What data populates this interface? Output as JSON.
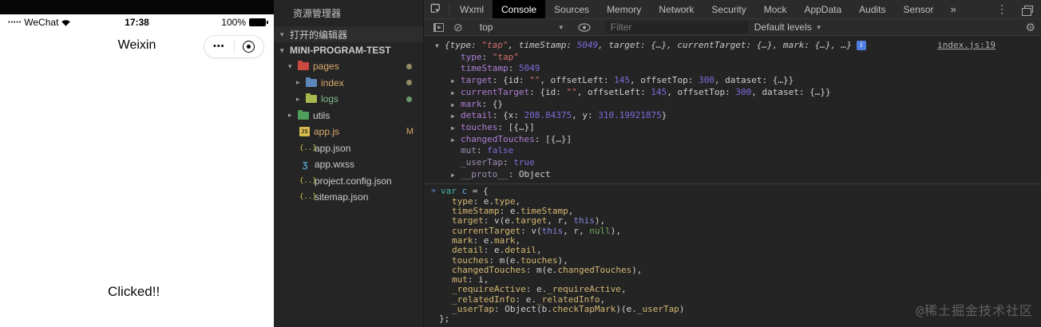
{
  "simulator": {
    "status": {
      "carrier_dots": "•••••",
      "carrier": "WeChat",
      "time": "17:38",
      "battery_pct": "100%"
    },
    "nav": {
      "title": "Weixin",
      "menu_dots": "•••"
    },
    "content": {
      "clicked_text": "Clicked!!"
    }
  },
  "explorer": {
    "title": "资源管理器",
    "open_editors_label": "打开的编辑器",
    "root_label": "MINI-PROGRAM-TEST",
    "items": [
      {
        "label": "pages",
        "icon": "folder",
        "icon_color": "#cc4940",
        "arrow": "down",
        "indent": 1,
        "color": "modified",
        "badge": "dot",
        "badge_color": "#948a66"
      },
      {
        "label": "index",
        "icon": "folder",
        "icon_color": "#5c87b8",
        "arrow": "right",
        "indent": 2,
        "color": "modified",
        "badge": "dot",
        "badge_color": "#948a66"
      },
      {
        "label": "logs",
        "icon": "folder",
        "icon_color": "#a9b84c",
        "arrow": "right",
        "indent": 2,
        "color": "untracked",
        "badge": "dot",
        "badge_color": "#6a9a6e"
      },
      {
        "label": "utils",
        "icon": "folder",
        "icon_color": "#4f9e59",
        "arrow": "right",
        "indent": 1,
        "color": "normal"
      },
      {
        "label": "app.js",
        "icon": "js",
        "indent": 1,
        "color": "modified",
        "badge": "M",
        "badge_color": "#d9a96b"
      },
      {
        "label": "app.json",
        "icon": "json",
        "indent": 1,
        "color": "normal"
      },
      {
        "label": "app.wxss",
        "icon": "wxss",
        "indent": 1,
        "color": "normal"
      },
      {
        "label": "project.config.json",
        "icon": "json",
        "indent": 1,
        "color": "normal"
      },
      {
        "label": "sitemap.json",
        "icon": "json",
        "indent": 1,
        "color": "normal"
      }
    ],
    "icons": {
      "json_glyph": "{..}",
      "js_glyph": "JS",
      "wxss_glyph": "ʒ"
    }
  },
  "devtools": {
    "tabs": [
      "Wxml",
      "Console",
      "Sources",
      "Memory",
      "Network",
      "Security",
      "Mock",
      "AppData",
      "Audits",
      "Sensor"
    ],
    "active_tab": "Console",
    "more_tabs_symbol": "»",
    "toolbar": {
      "context": "top",
      "filter_placeholder": "Filter",
      "levels_label": "Default levels"
    },
    "source_link": "index.js:19",
    "console_lines": [
      {
        "arrow": "down",
        "indent": 0,
        "info": true,
        "link": "index.js:19",
        "tokens": [
          [
            "pv",
            "{type: "
          ],
          [
            "pvs",
            "\"tap\""
          ],
          [
            "pv",
            ", timeStamp: "
          ],
          [
            "pvn",
            "5049"
          ],
          [
            "pv",
            ", target: {…}, currentTarget: {…}, mark: {…}, …}"
          ]
        ]
      },
      {
        "indent": 1,
        "tokens": [
          [
            "key",
            "type"
          ],
          [
            "pun",
            ": "
          ],
          [
            "str",
            "\"tap\""
          ]
        ]
      },
      {
        "indent": 1,
        "tokens": [
          [
            "key",
            "timeStamp"
          ],
          [
            "pun",
            ": "
          ],
          [
            "num",
            "5049"
          ]
        ]
      },
      {
        "arrow": "right",
        "indent": 1,
        "tokens": [
          [
            "key",
            "target"
          ],
          [
            "pun",
            ": {id: "
          ],
          [
            "str",
            "\"\""
          ],
          [
            "pun",
            ", offsetLeft: "
          ],
          [
            "num",
            "145"
          ],
          [
            "pun",
            ", offsetTop: "
          ],
          [
            "num",
            "300"
          ],
          [
            "pun",
            ", dataset: {…}}"
          ]
        ]
      },
      {
        "arrow": "right",
        "indent": 1,
        "tokens": [
          [
            "key",
            "currentTarget"
          ],
          [
            "pun",
            ": {id: "
          ],
          [
            "str",
            "\"\""
          ],
          [
            "pun",
            ", offsetLeft: "
          ],
          [
            "num",
            "145"
          ],
          [
            "pun",
            ", offsetTop: "
          ],
          [
            "num",
            "300"
          ],
          [
            "pun",
            ", dataset: {…}}"
          ]
        ]
      },
      {
        "arrow": "right",
        "indent": 1,
        "tokens": [
          [
            "key",
            "mark"
          ],
          [
            "pun",
            ": {}"
          ]
        ]
      },
      {
        "arrow": "right",
        "indent": 1,
        "tokens": [
          [
            "key",
            "detail"
          ],
          [
            "pun",
            ": {x: "
          ],
          [
            "num",
            "208.84375"
          ],
          [
            "pun",
            ", y: "
          ],
          [
            "num",
            "310.19921875"
          ],
          [
            "pun",
            "}"
          ]
        ]
      },
      {
        "arrow": "right",
        "indent": 1,
        "tokens": [
          [
            "key",
            "touches"
          ],
          [
            "pun",
            ": [{…}]"
          ]
        ]
      },
      {
        "arrow": "right",
        "indent": 1,
        "tokens": [
          [
            "key",
            "changedTouches"
          ],
          [
            "pun",
            ": [{…}]"
          ]
        ]
      },
      {
        "indent": 1,
        "tokens": [
          [
            "dim",
            "mut"
          ],
          [
            "pun",
            ": "
          ],
          [
            "num",
            "false"
          ]
        ]
      },
      {
        "indent": 1,
        "tokens": [
          [
            "dim",
            "_userTap"
          ],
          [
            "pun",
            ": "
          ],
          [
            "num",
            "true"
          ]
        ]
      },
      {
        "arrow": "right",
        "indent": 1,
        "tokens": [
          [
            "dim",
            "__proto__"
          ],
          [
            "pun",
            ": Object"
          ]
        ]
      }
    ],
    "echo_lines": [
      {
        "prompt": true,
        "indent": 0,
        "tokens": [
          [
            "kw",
            "var"
          ],
          [
            "pun",
            " "
          ],
          [
            "var",
            "c"
          ],
          [
            "pun",
            " = {"
          ]
        ]
      },
      {
        "indent": 1,
        "tokens": [
          [
            "prop",
            "type"
          ],
          [
            "pun",
            ": e."
          ],
          [
            "prop",
            "type"
          ],
          [
            "pun",
            ","
          ]
        ]
      },
      {
        "indent": 1,
        "tokens": [
          [
            "prop",
            "timeStamp"
          ],
          [
            "pun",
            ": e."
          ],
          [
            "prop",
            "timeStamp"
          ],
          [
            "pun",
            ","
          ]
        ]
      },
      {
        "indent": 1,
        "tokens": [
          [
            "prop",
            "target"
          ],
          [
            "pun",
            ": v(e."
          ],
          [
            "prop",
            "target"
          ],
          [
            "pun",
            ", r, "
          ],
          [
            "this",
            "this"
          ],
          [
            "pun",
            "),"
          ]
        ]
      },
      {
        "indent": 1,
        "tokens": [
          [
            "prop",
            "currentTarget"
          ],
          [
            "pun",
            ": v("
          ],
          [
            "this",
            "this"
          ],
          [
            "pun",
            ", r, "
          ],
          [
            "null",
            "null"
          ],
          [
            "pun",
            "),"
          ]
        ]
      },
      {
        "indent": 1,
        "tokens": [
          [
            "prop",
            "mark"
          ],
          [
            "pun",
            ": e."
          ],
          [
            "prop",
            "mark"
          ],
          [
            "pun",
            ","
          ]
        ]
      },
      {
        "indent": 1,
        "tokens": [
          [
            "prop",
            "detail"
          ],
          [
            "pun",
            ": e."
          ],
          [
            "prop",
            "detail"
          ],
          [
            "pun",
            ","
          ]
        ]
      },
      {
        "indent": 1,
        "tokens": [
          [
            "prop",
            "touches"
          ],
          [
            "pun",
            ": m(e."
          ],
          [
            "prop",
            "touches"
          ],
          [
            "pun",
            "),"
          ]
        ]
      },
      {
        "indent": 1,
        "tokens": [
          [
            "prop",
            "changedTouches"
          ],
          [
            "pun",
            ": m(e."
          ],
          [
            "prop",
            "changedTouches"
          ],
          [
            "pun",
            "),"
          ]
        ]
      },
      {
        "indent": 1,
        "tokens": [
          [
            "prop",
            "mut"
          ],
          [
            "pun",
            ": i,"
          ]
        ]
      },
      {
        "indent": 1,
        "tokens": [
          [
            "prop",
            "_requireActive"
          ],
          [
            "pun",
            ": e."
          ],
          [
            "prop",
            "_requireActive"
          ],
          [
            "pun",
            ","
          ]
        ]
      },
      {
        "indent": 1,
        "tokens": [
          [
            "prop",
            "_relatedInfo"
          ],
          [
            "pun",
            ": e."
          ],
          [
            "prop",
            "_relatedInfo"
          ],
          [
            "pun",
            ","
          ]
        ]
      },
      {
        "indent": 1,
        "tokens": [
          [
            "prop",
            "_userTap"
          ],
          [
            "pun",
            ": Object(b."
          ],
          [
            "prop",
            "checkTapMark"
          ],
          [
            "pun",
            ")(e."
          ],
          [
            "prop",
            "_userTap"
          ],
          [
            "pun",
            ")"
          ]
        ]
      },
      {
        "indent": 2,
        "tokens": [
          [
            "pun",
            "};"
          ]
        ]
      }
    ]
  },
  "watermark": "@稀土掘金技术社区",
  "colors": {
    "console_bg": "#242424",
    "toolbar_bg": "#2b2b2b",
    "explorer_bg": "#252526",
    "active_tab_bg": "#000000",
    "key_purple": "#b07fd6",
    "string_red": "#d2706a",
    "number_violet": "#7b6ede",
    "code_prop_tan": "#d5b874",
    "keyword_teal": "#43b9a6",
    "modified_orange": "#d9a96b",
    "untracked_green": "#81b88b",
    "info_blue": "#4e7fe0"
  }
}
